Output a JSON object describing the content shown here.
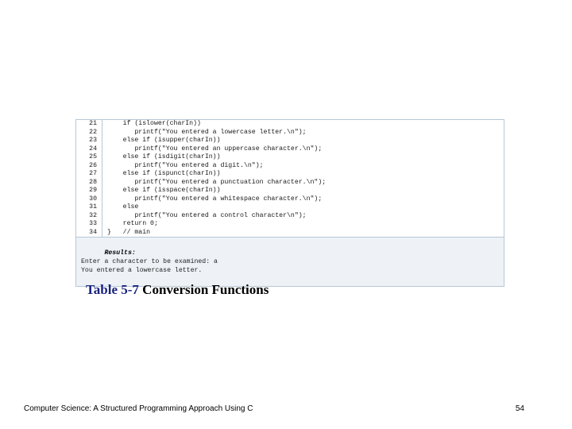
{
  "code": {
    "lines": [
      {
        "n": "21",
        "t": "    if (islower(charIn))"
      },
      {
        "n": "22",
        "t": "       printf(\"You entered a lowercase letter.\\n\");"
      },
      {
        "n": "23",
        "t": "    else if (isupper(charIn))"
      },
      {
        "n": "24",
        "t": "       printf(\"You entered an uppercase character.\\n\");"
      },
      {
        "n": "25",
        "t": "    else if (isdigit(charIn))"
      },
      {
        "n": "26",
        "t": "       printf(\"You entered a digit.\\n\");"
      },
      {
        "n": "27",
        "t": "    else if (ispunct(charIn))"
      },
      {
        "n": "28",
        "t": "       printf(\"You entered a punctuation character.\\n\");"
      },
      {
        "n": "29",
        "t": "    else if (isspace(charIn))"
      },
      {
        "n": "30",
        "t": "       printf(\"You entered a whitespace character.\\n\");"
      },
      {
        "n": "31",
        "t": "    else"
      },
      {
        "n": "32",
        "t": "       printf(\"You entered a control character\\n\");"
      },
      {
        "n": "33",
        "t": "    return 0;"
      },
      {
        "n": "34",
        "t": "}   // main"
      }
    ],
    "results_header": "Results:",
    "results_line1": "Enter a character to be examined: a",
    "results_line2": "You entered a lowercase letter."
  },
  "caption": {
    "lead": "Table  5-7  ",
    "title": "Conversion Functions"
  },
  "footer": {
    "left": "Computer Science: A Structured Programming Approach Using C",
    "right": "54"
  }
}
